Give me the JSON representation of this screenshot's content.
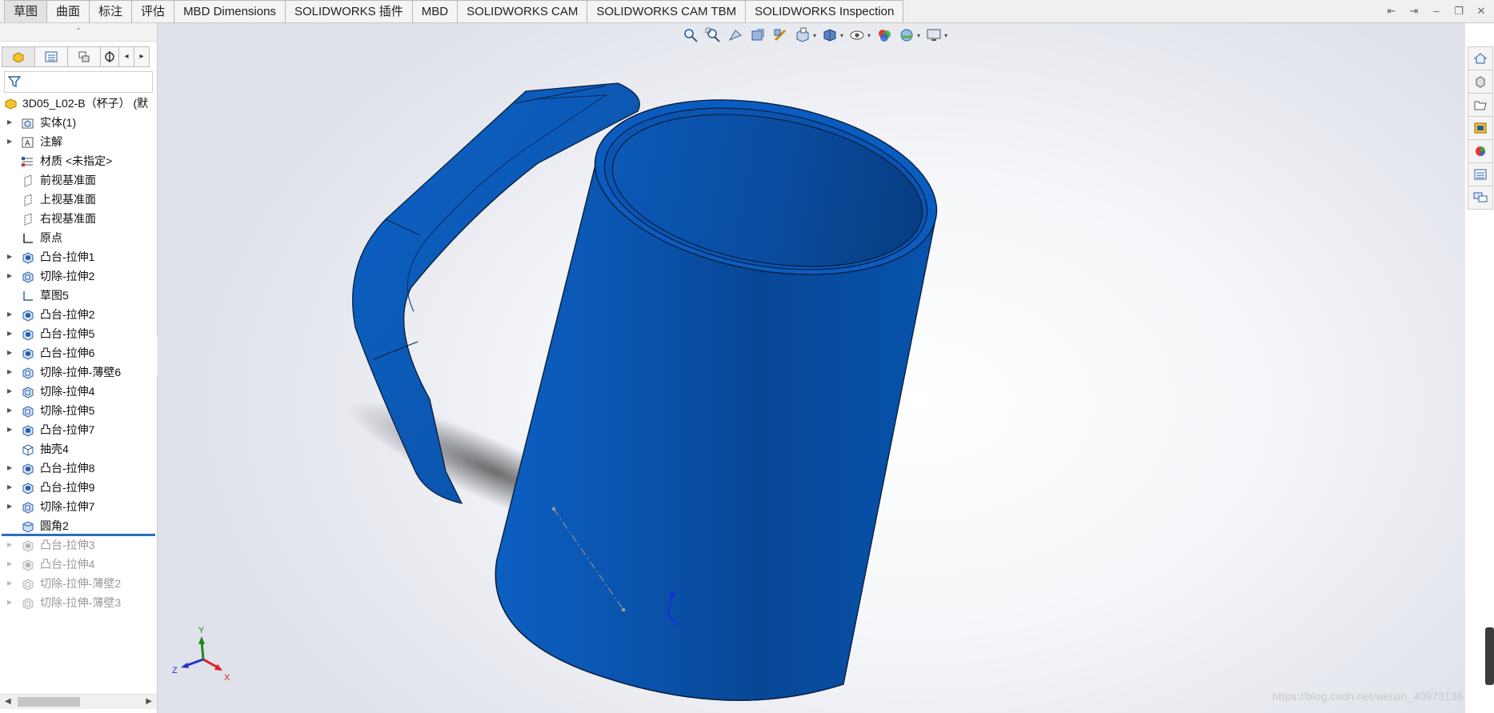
{
  "ribbon": {
    "tabs": [
      "草图",
      "曲面",
      "标注",
      "评估",
      "MBD Dimensions",
      "SOLIDWORKS 插件",
      "MBD",
      "SOLIDWORKS CAM",
      "SOLIDWORKS CAM TBM",
      "SOLIDWORKS Inspection"
    ],
    "active_tab": "草图"
  },
  "feature_tree": {
    "root": "3D05_L02-B（杯子） (默",
    "items": [
      {
        "label": "实体(1)",
        "icon": "solid-bodies-icon"
      },
      {
        "label": "注解",
        "icon": "annotations-icon"
      },
      {
        "label": "材质 <未指定>",
        "icon": "material-icon"
      },
      {
        "label": "前视基准面",
        "icon": "plane-icon"
      },
      {
        "label": "上视基准面",
        "icon": "plane-icon"
      },
      {
        "label": "右视基准面",
        "icon": "plane-icon"
      },
      {
        "label": "原点",
        "icon": "origin-icon"
      },
      {
        "label": "凸台-拉伸1",
        "icon": "boss-extrude-icon"
      },
      {
        "label": "切除-拉伸2",
        "icon": "cut-extrude-icon"
      },
      {
        "label": "草图5",
        "icon": "sketch-icon"
      },
      {
        "label": "凸台-拉伸2",
        "icon": "boss-extrude-icon"
      },
      {
        "label": "凸台-拉伸5",
        "icon": "boss-extrude-icon"
      },
      {
        "label": "凸台-拉伸6",
        "icon": "boss-extrude-icon"
      },
      {
        "label": "切除-拉伸-薄壁6",
        "icon": "cut-extrude-icon"
      },
      {
        "label": "切除-拉伸4",
        "icon": "cut-extrude-icon"
      },
      {
        "label": "切除-拉伸5",
        "icon": "cut-extrude-icon"
      },
      {
        "label": "凸台-拉伸7",
        "icon": "boss-extrude-icon"
      },
      {
        "label": "抽壳4",
        "icon": "shell-icon"
      },
      {
        "label": "凸台-拉伸8",
        "icon": "boss-extrude-icon"
      },
      {
        "label": "凸台-拉伸9",
        "icon": "boss-extrude-icon"
      },
      {
        "label": "切除-拉伸7",
        "icon": "cut-extrude-icon"
      },
      {
        "label": "圆角2",
        "icon": "fillet-icon"
      }
    ],
    "suppressed_items": [
      {
        "label": "凸台-拉伸3"
      },
      {
        "label": "凸台-拉伸4"
      },
      {
        "label": "切除-拉伸-薄壁2"
      },
      {
        "label": "切除-拉伸-薄壁3"
      }
    ]
  },
  "triad": {
    "x": "X",
    "y": "Y",
    "z": "Z"
  },
  "watermark": "https://blog.csdn.net/weixin_40973138",
  "colors": {
    "model": "#0b4fa6",
    "model_dark": "#06367a",
    "accent": "#2a6ebd"
  }
}
